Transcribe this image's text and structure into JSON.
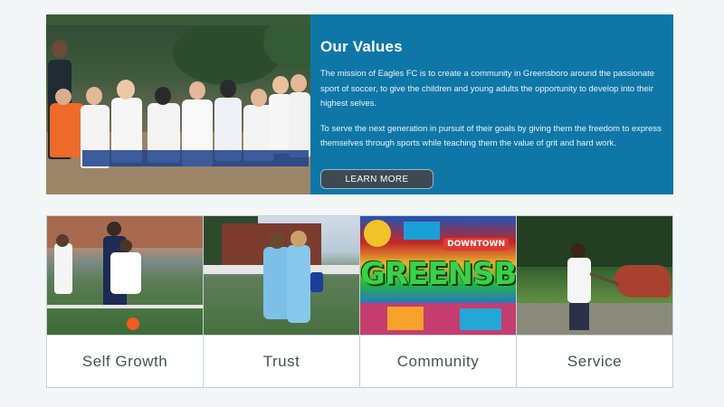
{
  "values": {
    "title": "Our Values",
    "paragraph1": "The mission of Eagles FC is to create a community in Greensboro around the passionate sport of soccer, to give the children and young adults the opportunity to develop into their highest selves.",
    "paragraph2": "To serve the next generation in pursuit of their goals by giving them the freedom to express themselves through sports while teaching them the value of grit and hard work.",
    "button_label": "LEARN MORE",
    "panel_color": "#0f77a8"
  },
  "cards": [
    {
      "label": "Self Growth"
    },
    {
      "label": "Trust"
    },
    {
      "label": "Community"
    },
    {
      "label": "Service"
    }
  ],
  "mural": {
    "main_word": "GREENSBORO",
    "sign": "DOWNTOWN"
  }
}
